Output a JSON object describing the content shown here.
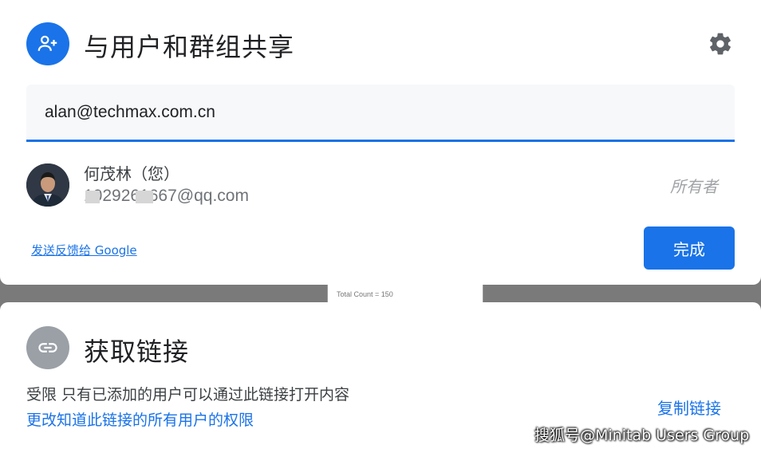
{
  "background": {
    "chart_snippet_text": "Total Count = 150"
  },
  "share_dialog": {
    "title": "与用户和群组共享",
    "icon": "person-add-icon",
    "settings_icon": "gear-icon",
    "email_input_value": "alan@techmax.com.cn",
    "user": {
      "name": "何茂林（您）",
      "email": "1029261667@qq.com",
      "role": "所有者"
    },
    "feedback_link": "发送反馈给 Google",
    "done_button": "完成"
  },
  "link_dialog": {
    "title": "获取链接",
    "icon": "link-icon",
    "restriction_text": "受限 只有已添加的用户可以通过此链接打开内容",
    "change_link": "更改知道此链接的所有用户的权限",
    "copy_link": "复制链接"
  },
  "watermark": "搜狐号@Minitab Users Group",
  "colors": {
    "accent": "#1a73e8",
    "link_icon_bg": "#9aa0a6",
    "overlay": "#7a7a7a"
  }
}
